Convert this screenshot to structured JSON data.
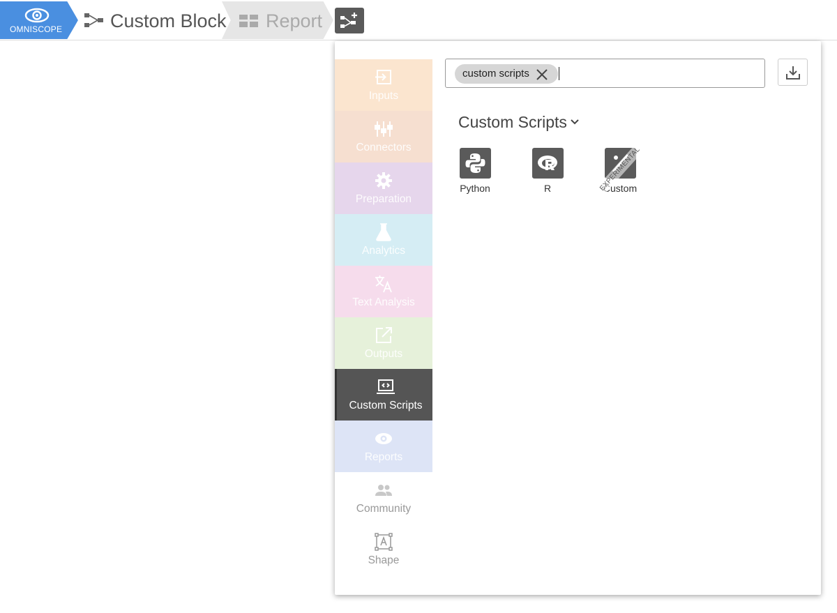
{
  "app": {
    "logo_text": "OMNISCOPE"
  },
  "breadcrumb": {
    "items": [
      {
        "label": "Custom Block"
      },
      {
        "label": "Report"
      }
    ]
  },
  "search": {
    "chip_label": "custom scripts",
    "value": ""
  },
  "categories": [
    {
      "label": "Inputs",
      "color": "#fbe5cf",
      "icon": "input-icon"
    },
    {
      "label": "Connectors",
      "color": "#f6dfd0",
      "icon": "connectors-icon"
    },
    {
      "label": "Preparation",
      "color": "#e6d6ec",
      "icon": "gear-icon"
    },
    {
      "label": "Analytics",
      "color": "#d5edf4",
      "icon": "flask-icon"
    },
    {
      "label": "Text Analysis",
      "color": "#f6dcec",
      "icon": "translate-icon"
    },
    {
      "label": "Outputs",
      "color": "#e6f1da",
      "icon": "external-link-icon"
    },
    {
      "label": "Custom Scripts",
      "color": "#555555",
      "icon": "code-screen-icon",
      "active": true
    },
    {
      "label": "Reports",
      "color": "#dde4f6",
      "icon": "eye-icon"
    },
    {
      "label": "Community",
      "color": "#ffffff",
      "icon": "people-icon"
    },
    {
      "label": "Shape",
      "color": "#ffffff",
      "icon": "shape-icon"
    }
  ],
  "section": {
    "title": "Custom Scripts"
  },
  "blocks": [
    {
      "label": "Python",
      "icon": "python-icon"
    },
    {
      "label": "R",
      "icon": "r-icon"
    },
    {
      "label": "Custom",
      "icon": "custom-block-icon",
      "badge": "EXPERIMENTAL"
    }
  ]
}
